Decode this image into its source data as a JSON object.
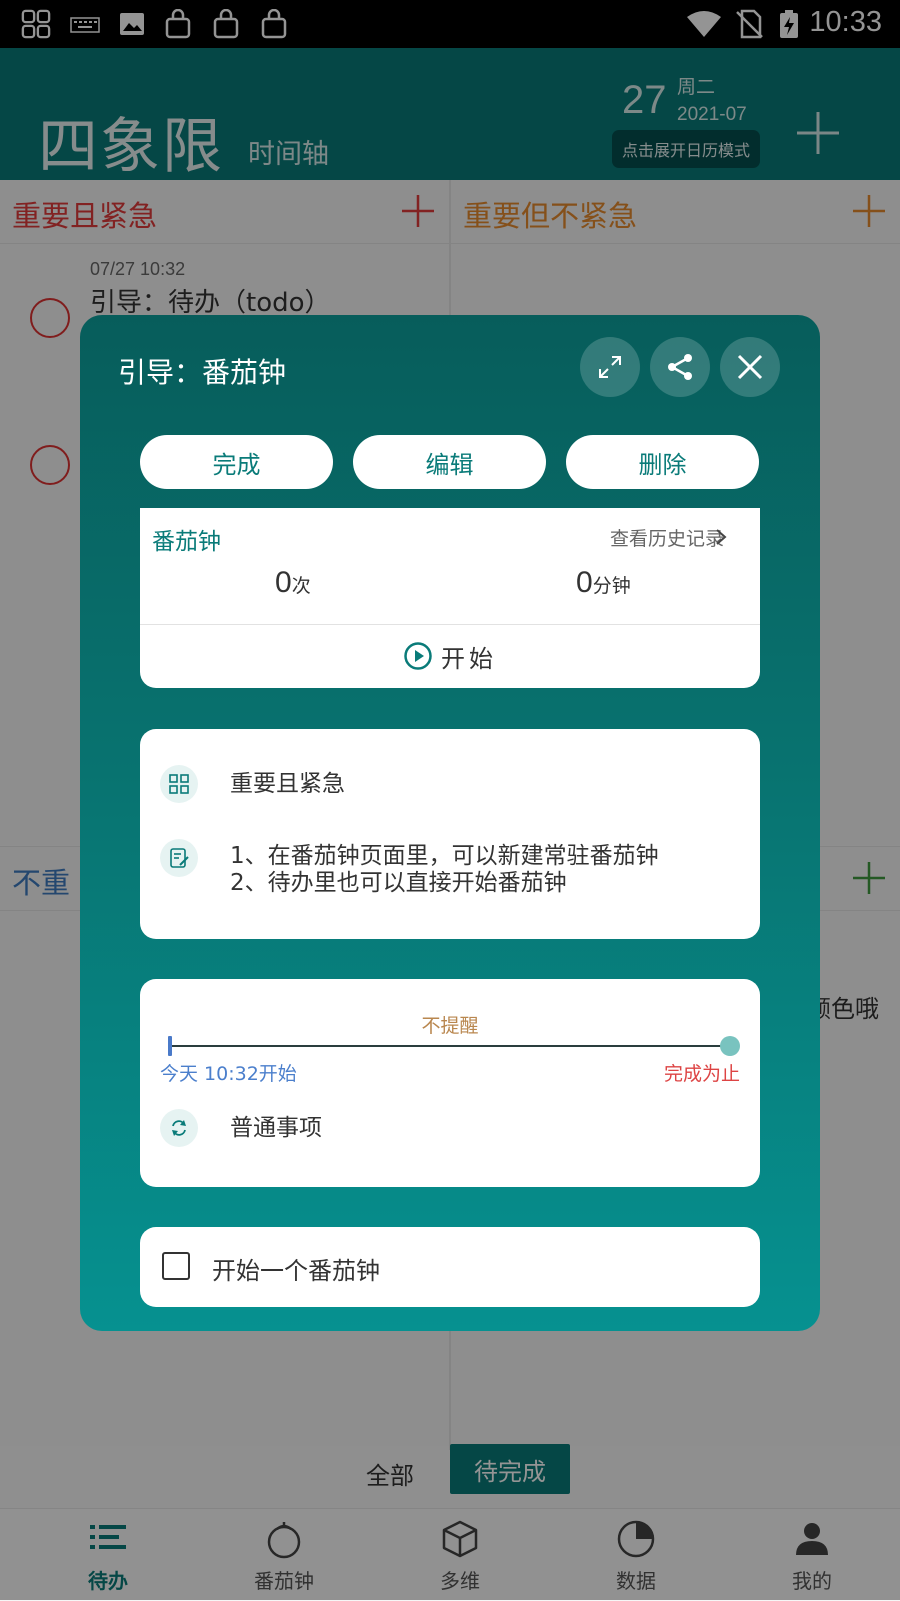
{
  "status_bar": {
    "time": "10:33"
  },
  "header": {
    "title": "四象限",
    "timeline_tab": "时间轴",
    "date_day": "27",
    "date_weekday": "周二",
    "date_month": "2021-07",
    "calendar_button": "点击展开日历模式"
  },
  "quadrants": {
    "urgent_important": {
      "title": "重要且紧急",
      "color": "#e03b3b"
    },
    "important_not_urgent": {
      "title": "重要但不紧急",
      "color": "#e68a2e"
    },
    "bottom_left_partial": "不重"
  },
  "task": {
    "time": "07/27 10:32",
    "title": "引导：待办（todo）"
  },
  "peek_text": "颜色哦",
  "filters": {
    "all": "全部",
    "pending": "待完成"
  },
  "nav": [
    {
      "label": "待办",
      "icon": "list-icon"
    },
    {
      "label": "番茄钟",
      "icon": "tomato-icon"
    },
    {
      "label": "多维",
      "icon": "cube-icon"
    },
    {
      "label": "数据",
      "icon": "pie-chart-icon"
    },
    {
      "label": "我的",
      "icon": "person-icon"
    }
  ],
  "dialog": {
    "title": "引导：番茄钟",
    "buttons": {
      "done": "完成",
      "edit": "编辑",
      "delete": "删除"
    },
    "pomodoro": {
      "title": "番茄钟",
      "history": "查看历史记录",
      "count": "0",
      "count_unit": "次",
      "minutes": "0",
      "minutes_unit": "分钟",
      "start": "开始"
    },
    "quadrant_label": "重要且紧急",
    "note_line1": "1、在番茄钟页面里，可以新建常驻番茄钟",
    "note_line2": "2、待办里也可以直接开始番茄钟",
    "reminder": "不提醒",
    "start_time": "今天 10:32开始",
    "end_time": "完成为止",
    "repeat": "普通事项",
    "checkbox_label": "开始一个番茄钟"
  },
  "colors": {
    "accent": "#0a7b79",
    "red": "#d33",
    "orange": "#e68a2e"
  }
}
